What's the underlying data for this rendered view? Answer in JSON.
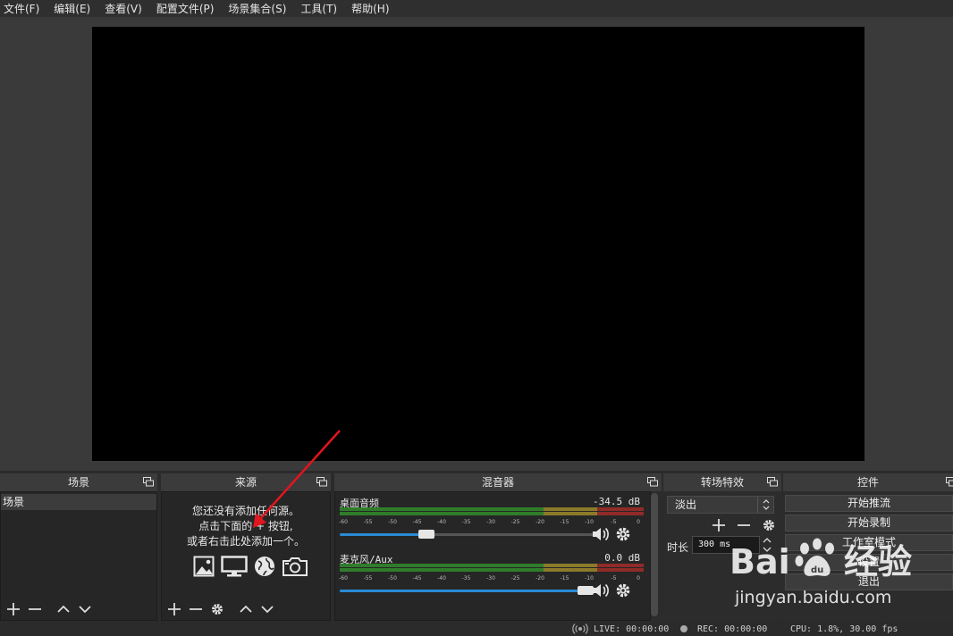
{
  "menu": [
    "文件(F)",
    "编辑(E)",
    "查看(V)",
    "配置文件(P)",
    "场景集合(S)",
    "工具(T)",
    "帮助(H)"
  ],
  "docks": {
    "scenes": {
      "title": "场景",
      "items": [
        "场景"
      ]
    },
    "sources": {
      "title": "来源",
      "hint_lines": [
        "您还没有添加任何源。",
        "点击下面的 + 按钮,",
        "或者右击此处添加一个。"
      ]
    },
    "mixer": {
      "title": "混音器",
      "tick_labels": [
        "-60",
        "-55",
        "-50",
        "-45",
        "-40",
        "-35",
        "-30",
        "-25",
        "-20",
        "-15",
        "-10",
        "-5",
        "0"
      ],
      "channels": [
        {
          "name": "桌面音频",
          "db": "-34.5 dB",
          "volume": 0.33
        },
        {
          "name": "麦克风/Aux",
          "db": "0.0 dB",
          "volume": 1.0
        }
      ]
    },
    "transitions": {
      "title": "转场特效",
      "selected": "淡出",
      "duration_label": "时长",
      "duration_value": "300 ms"
    },
    "controls": {
      "title": "控件",
      "buttons": [
        "开始推流",
        "开始录制",
        "工作室模式",
        "设置",
        "退出"
      ]
    }
  },
  "status": {
    "live": "LIVE: 00:00:00",
    "rec": "REC: 00:00:00",
    "cpu": "CPU: 1.8%, 30.00 fps"
  },
  "watermark": {
    "text": "jingyan.baidu.com"
  },
  "colors": {
    "accent": "#2a8bd6",
    "annotation_arrow": "#e0161e",
    "meter_green": "#39a62f",
    "meter_yellow": "#c7a42a",
    "meter_red": "#c8302c"
  }
}
